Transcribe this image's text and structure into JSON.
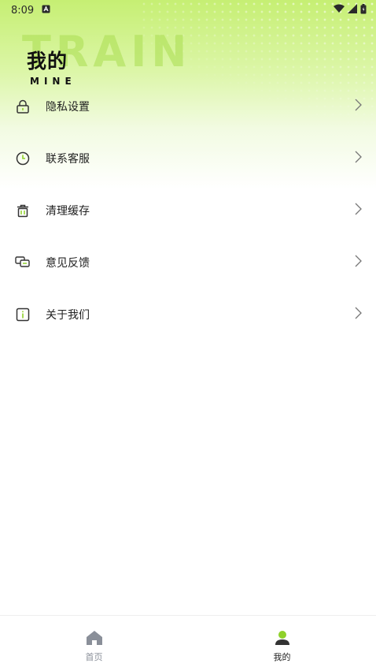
{
  "status_bar": {
    "time": "8:09",
    "notification_icon": "a-icon",
    "wifi_icon": "wifi-icon",
    "signal_icon": "signal-icon",
    "battery_icon": "battery-icon"
  },
  "header": {
    "background_word": "TRAIN",
    "title": "我的",
    "subtitle": "MINE"
  },
  "menu": {
    "items": [
      {
        "label": "隐私设置",
        "icon": "lock-icon"
      },
      {
        "label": "联系客服",
        "icon": "clock-icon"
      },
      {
        "label": "清理缓存",
        "icon": "trash-icon"
      },
      {
        "label": "意见反馈",
        "icon": "chat-icon"
      },
      {
        "label": "关于我们",
        "icon": "info-icon"
      }
    ]
  },
  "tab_bar": {
    "tabs": [
      {
        "label": "首页",
        "icon": "home-icon",
        "active": false
      },
      {
        "label": "我的",
        "icon": "user-icon",
        "active": true
      }
    ]
  },
  "colors": {
    "accent": "#8fd12a",
    "inactive": "#8a8f99"
  }
}
